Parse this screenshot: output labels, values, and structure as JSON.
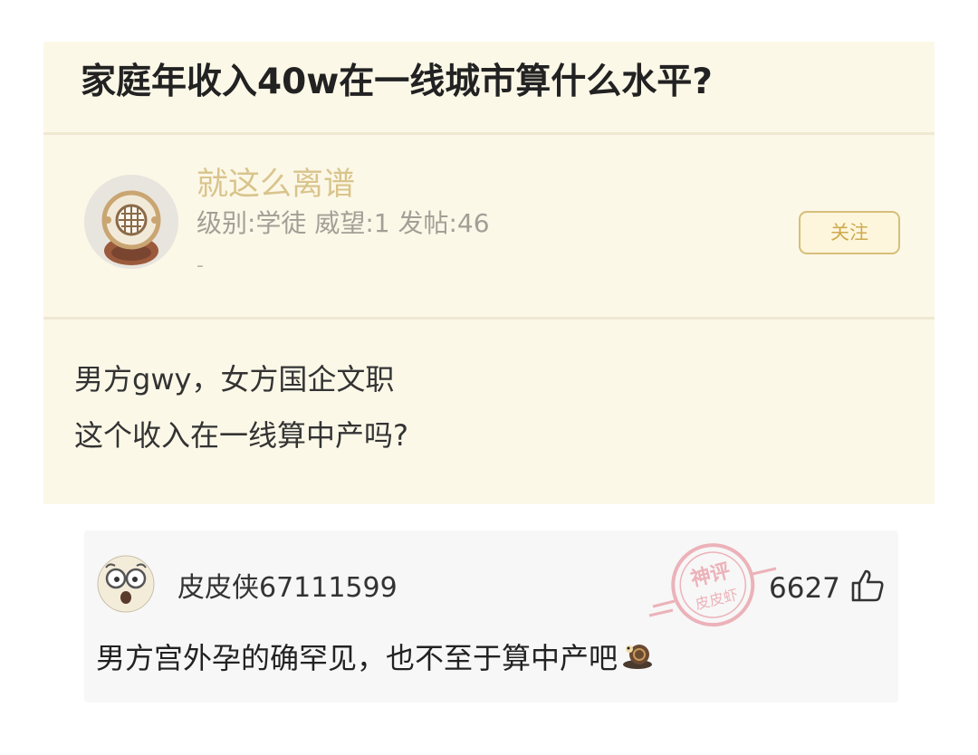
{
  "post": {
    "title": "家庭年收入40w在一线城市算什么水平?",
    "author": {
      "name": "就这么离谱",
      "meta": "级别:学徒 威望:1 发帖:46",
      "signature": "-"
    },
    "follow_label": "关注",
    "body_lines": [
      "男方gwy，女方国企文职",
      "这个收入在一线算中产吗?"
    ]
  },
  "comment": {
    "username": "皮皮侠67111599",
    "likes": "6627",
    "text": "男方宫外孕的确罕见，也不至于算中产吧",
    "stamp": {
      "line1": "神评",
      "line2": "皮皮虾"
    }
  },
  "colors": {
    "card_background": "#fcf8e8",
    "username_gold": "#d9c48c",
    "follow_gold": "#d6bf7a",
    "stamp_red": "#e06070"
  },
  "icons": {
    "author_avatar": "diving-helmet-avatar",
    "comment_avatar": "cartoon-face-avatar",
    "like": "thumbs-up-icon",
    "emoji": "snail-emoji"
  }
}
